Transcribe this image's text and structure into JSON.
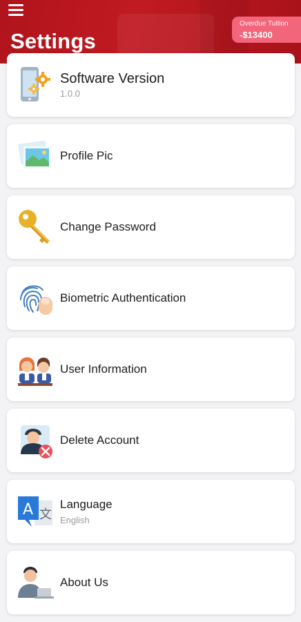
{
  "header": {
    "title": "Settings",
    "tuition_label": "Overdue Tuition",
    "tuition_amount": "-$13400",
    "menu_icon": "hamburger-menu-icon",
    "brand_color": "#c11a22",
    "badge_color": "#f2657a"
  },
  "settings": {
    "items": [
      {
        "icon": "phone-gears-icon",
        "title": "Software Version",
        "subtitle": "1.0.0"
      },
      {
        "icon": "photo-icon",
        "title": "Profile Pic"
      },
      {
        "icon": "key-icon",
        "title": "Change Password"
      },
      {
        "icon": "fingerprint-icon",
        "title": "Biometric Authentication"
      },
      {
        "icon": "users-icon",
        "title": "User Information"
      },
      {
        "icon": "delete-user-icon",
        "title": "Delete Account"
      },
      {
        "icon": "translate-icon",
        "title": "Language",
        "subtitle": "English"
      },
      {
        "icon": "person-laptop-icon",
        "title": "About Us"
      }
    ]
  }
}
